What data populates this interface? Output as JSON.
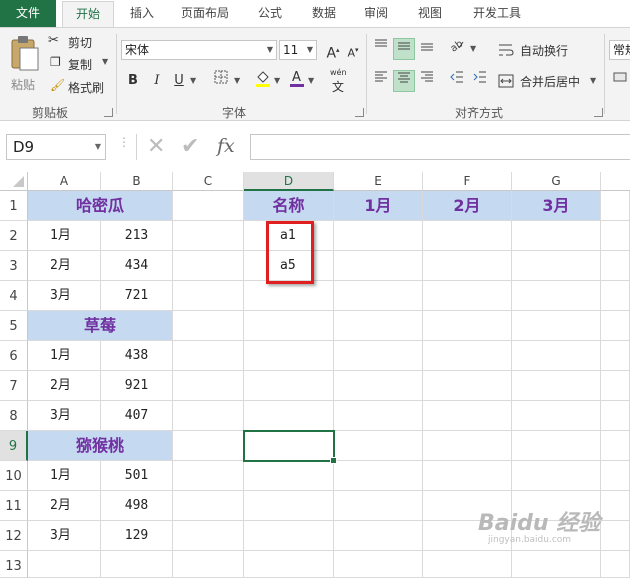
{
  "tabs": [
    "文件",
    "开始",
    "插入",
    "页面布局",
    "公式",
    "数据",
    "审阅",
    "视图",
    "开发工具"
  ],
  "clipboard": {
    "paste": "粘贴",
    "cut": "剪切",
    "copy": "复制",
    "format_painter": "格式刷",
    "group_label": "剪贴板"
  },
  "font": {
    "name": "宋体",
    "size": "11",
    "bold": "B",
    "italic": "I",
    "underline": "U",
    "phonetic": "wén",
    "group_label": "字体"
  },
  "alignment": {
    "wrap_text": "自动换行",
    "merge_center": "合并后居中",
    "group_label": "对齐方式"
  },
  "number": {
    "format": "常规"
  },
  "formula_bar": {
    "name_box": "D9",
    "fx": "fx",
    "value": ""
  },
  "columns": [
    "A",
    "B",
    "C",
    "D",
    "E",
    "F",
    "G"
  ],
  "rows": [
    "1",
    "2",
    "3",
    "4",
    "5",
    "6",
    "7",
    "8",
    "9",
    "10",
    "11",
    "12",
    "13"
  ],
  "sheet": {
    "A1": "哈密瓜",
    "A2": "1月",
    "B2": "213",
    "A3": "2月",
    "B3": "434",
    "A4": "3月",
    "B4": "721",
    "A5": "草莓",
    "A6": "1月",
    "B6": "438",
    "A7": "2月",
    "B7": "921",
    "A8": "3月",
    "B8": "407",
    "A9": "猕猴桃",
    "A10": "1月",
    "B10": "501",
    "A11": "2月",
    "B11": "498",
    "A12": "3月",
    "B12": "129",
    "D1": "名称",
    "E1": "1月",
    "F1": "2月",
    "G1": "3月",
    "D2": "a1",
    "D3": "a5"
  },
  "watermark": {
    "main": "Baidu 经验",
    "sub": "jingyan.baidu.com"
  },
  "colors": {
    "accent": "#217346",
    "header_fill": "#c5d9f1",
    "header_text": "#7030a0",
    "highlight": "#e02020"
  }
}
